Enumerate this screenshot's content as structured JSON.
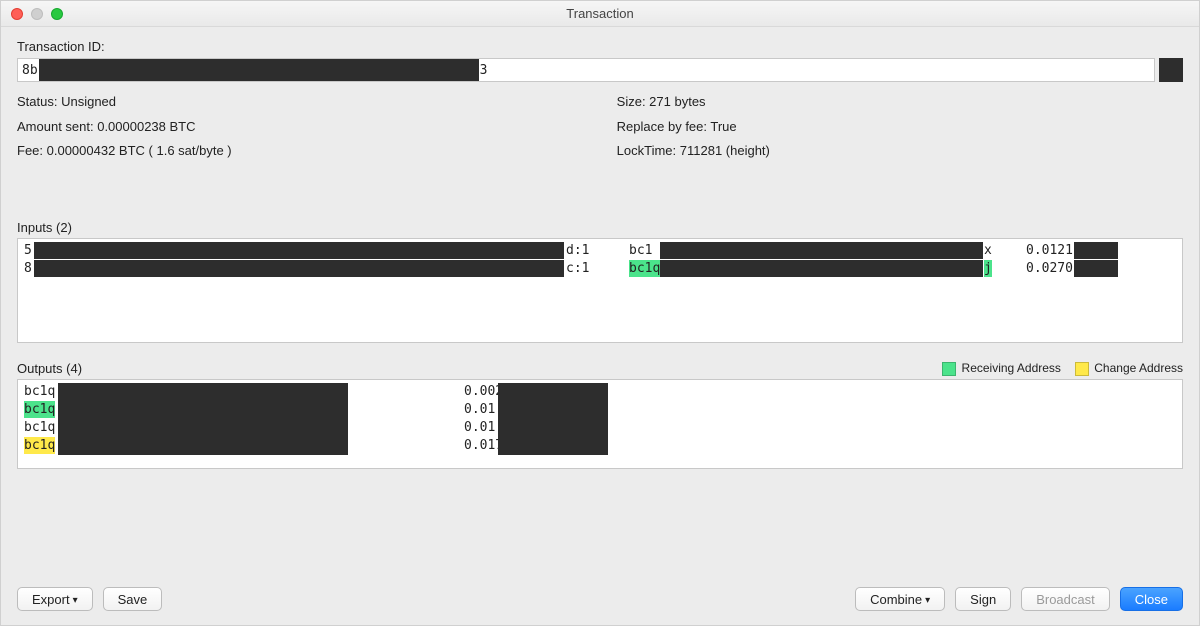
{
  "window_title": "Transaction",
  "txid_label": "Transaction ID:",
  "txid_prefix": "8b",
  "txid_suffix": "3",
  "stats_left": {
    "status": "Status: Unsigned",
    "amount_sent": "Amount sent: 0.00000238 BTC",
    "fee": "Fee: 0.00000432 BTC  ( 1.6 sat/byte )"
  },
  "stats_right": {
    "size": "Size: 271 bytes",
    "rbf": "Replace by fee: True",
    "locktime": "LockTime: 711281 (height)"
  },
  "inputs": {
    "header": "Inputs (2)",
    "rows": [
      {
        "txref_pre": "5",
        "txref_suf": "d:1",
        "addr_pre": "bc1",
        "addr_pre_hl": false,
        "addr_suf": "x",
        "addr_suf_hl": false,
        "amount": "0.0121"
      },
      {
        "txref_pre": "8",
        "txref_suf": "c:1",
        "addr_pre": "bc1q",
        "addr_pre_hl": true,
        "addr_suf": "j",
        "addr_suf_hl": true,
        "amount": "0.0270"
      }
    ]
  },
  "outputs": {
    "header": "Outputs (4)",
    "legend_recv": "Receiving Address",
    "legend_change": "Change Address",
    "rows": [
      {
        "addr_pre": "bc1q",
        "hl": "",
        "amount": "0.002"
      },
      {
        "addr_pre": "bc1q",
        "hl": "recv",
        "amount": "0.01"
      },
      {
        "addr_pre": "bc1q",
        "hl": "",
        "amount": "0.01"
      },
      {
        "addr_pre": "bc1q",
        "hl": "change",
        "amount": "0.017"
      }
    ]
  },
  "buttons": {
    "export": "Export",
    "save": "Save",
    "combine": "Combine",
    "sign": "Sign",
    "broadcast": "Broadcast",
    "close": "Close"
  },
  "colors": {
    "receiving": "#4be38b",
    "change": "#ffe94a",
    "primary": "#1a7cff"
  }
}
